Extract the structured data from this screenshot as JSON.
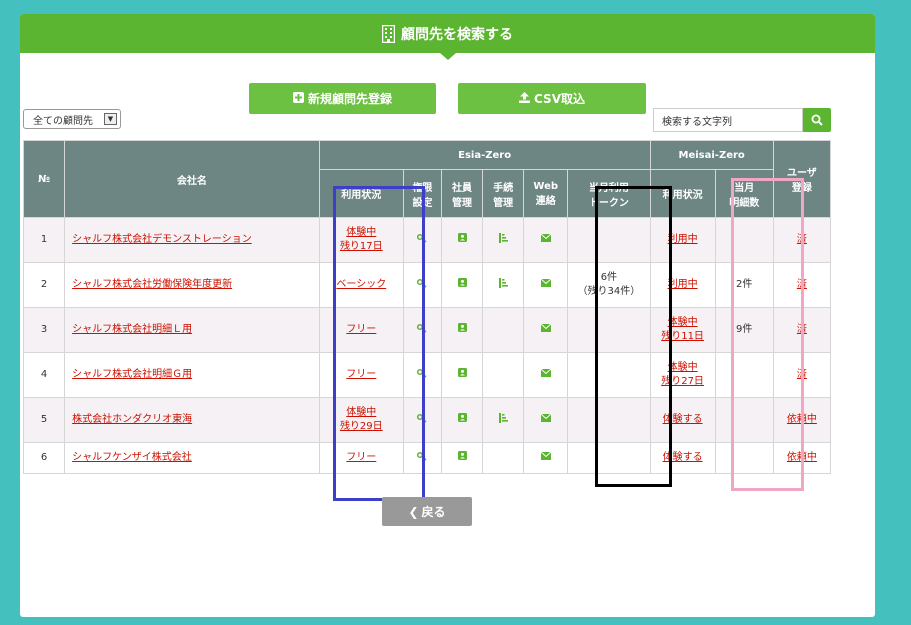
{
  "header": {
    "title": "顧問先を検索する",
    "icon": "building-icon"
  },
  "buttons": {
    "new_label": "新規顧問先登録",
    "csv_label": "CSV取込",
    "back_label": "戻る"
  },
  "filter": {
    "selected": "全ての顧問先"
  },
  "search": {
    "placeholder": "検索する文字列"
  },
  "table": {
    "group_esia": "Esia-Zero",
    "group_meisai": "Meisai-Zero",
    "h_no": "№",
    "h_company": "会社名",
    "h_status": "利用状況",
    "h_perm_1": "権限",
    "h_perm_2": "設定",
    "h_emp_1": "社員",
    "h_emp_2": "管理",
    "h_proc_1": "手続",
    "h_proc_2": "管理",
    "h_web_1": "Web",
    "h_web_2": "連絡",
    "h_token_1": "当月利用",
    "h_token_2": "トークン",
    "h_mstatus": "利用状況",
    "h_detail_1": "当月",
    "h_detail_2": "明細数",
    "h_user_1": "ユーザ",
    "h_user_2": "登録",
    "rows": [
      {
        "no": "1",
        "company": "シャルフ株式会社デモンストレーション",
        "status_1": "体験中",
        "status_2": "残り17日",
        "token_1": "",
        "token_2": "",
        "mstatus_1": "利用中",
        "mstatus_2": "",
        "detail": "",
        "user": "済"
      },
      {
        "no": "2",
        "company": "シャルフ株式会社労働保険年度更新",
        "status_1": "ベーシック",
        "status_2": "",
        "token_1": "6件",
        "token_2": "（残り34件）",
        "mstatus_1": "利用中",
        "mstatus_2": "",
        "detail": "2件",
        "user": "済"
      },
      {
        "no": "3",
        "company": "シャルフ株式会社明細Ｌ用",
        "status_1": "フリー",
        "status_2": "",
        "token_1": "",
        "token_2": "",
        "mstatus_1": "体験中",
        "mstatus_2": "残り11日",
        "detail": "9件",
        "user": "済"
      },
      {
        "no": "4",
        "company": "シャルフ株式会社明細Ｇ用",
        "status_1": "フリー",
        "status_2": "",
        "token_1": "",
        "token_2": "",
        "mstatus_1": "体験中",
        "mstatus_2": "残り27日",
        "detail": "",
        "user": "済"
      },
      {
        "no": "5",
        "company": "株式会社ホンダクリオ東海",
        "status_1": "体験中",
        "status_2": "残り29日",
        "token_1": "",
        "token_2": "",
        "mstatus_1": "体験する",
        "mstatus_2": "",
        "detail": "",
        "user": "依頼中"
      },
      {
        "no": "6",
        "company": "シャルフケンザイ株式会社",
        "status_1": "フリー",
        "status_2": "",
        "token_1": "",
        "token_2": "",
        "mstatus_1": "体験する",
        "mstatus_2": "",
        "detail": "",
        "user": "依頼中"
      }
    ]
  },
  "colors": {
    "header_green": "#5cb531",
    "button_green": "#6cc042",
    "table_header": "#6d8583",
    "link_red": "#cc1100",
    "highlight_blue": "#3d3fc8",
    "highlight_black": "#000000",
    "highlight_pink": "#f2a6c6",
    "icon_green": "#5cb531"
  }
}
